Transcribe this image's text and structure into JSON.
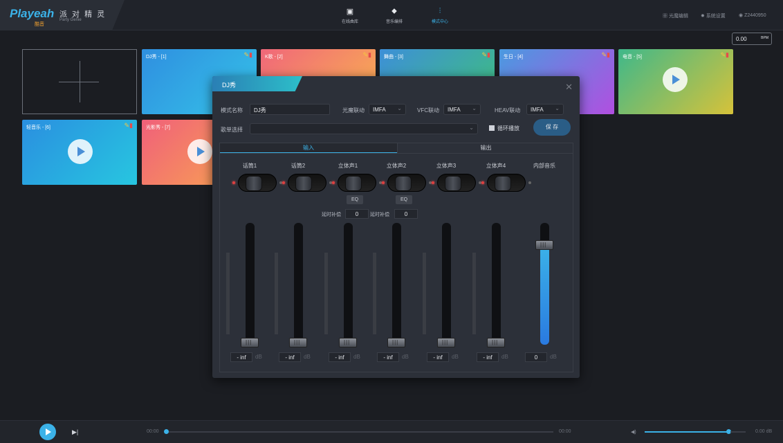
{
  "app": {
    "logo": "Playeah",
    "logo_sub": "酷音",
    "name_cn": "派 对 精 灵",
    "name_en": "Party Genie"
  },
  "nav": [
    {
      "label": "在线曲库",
      "icon": "music-box-icon"
    },
    {
      "label": "音乐编排",
      "icon": "arrange-icon"
    },
    {
      "label": "模式中心",
      "icon": "mixer-icon"
    }
  ],
  "topright": {
    "light_edit": "光魔编辑",
    "settings": "系统设置",
    "user": "Z2440950"
  },
  "bpm": {
    "value": "0.00",
    "unit": "BPM"
  },
  "cards": [
    {
      "title": "DJ秀 - [1]",
      "colors": [
        "#2f8fe0",
        "#35c3e8"
      ]
    },
    {
      "title": "K歌 - [2]",
      "colors": [
        "#f0677a",
        "#f9b34f"
      ]
    },
    {
      "title": "舞曲 - [3]",
      "colors": [
        "#3d8fd8",
        "#3fc17a"
      ]
    },
    {
      "title": "生日 - [4]",
      "colors": [
        "#4a9ae0",
        "#b14fe0"
      ]
    },
    {
      "title": "电音 - [5]",
      "colors": [
        "#3fb88a",
        "#d6c23a"
      ]
    },
    {
      "title": "轻音乐 - [6]",
      "colors": [
        "#2a8fe0",
        "#27c6e0"
      ]
    },
    {
      "title": "光影秀 - [7]",
      "colors": [
        "#f0607a",
        "#f9a84f"
      ]
    }
  ],
  "modal": {
    "title": "DJ秀",
    "mode_name_label": "模式名称",
    "mode_name_value": "DJ秀",
    "light_label": "光魔联动",
    "light_value": "IMFA",
    "vfc_label": "VFC联动",
    "vfc_value": "IMFA",
    "heav_label": "HEAV联动",
    "heav_value": "IMFA",
    "playlist_label": "歌单选择",
    "playlist_value": "",
    "loop_label": "循环播放",
    "save_label": "保 存",
    "tab_input": "输入",
    "tab_output": "输出",
    "eq_label": "EQ",
    "delay_label": "延时补偿",
    "delay_value": "0",
    "db_unit": "dB",
    "channels": [
      {
        "name": "话筒1",
        "db": "- inf",
        "level": 0
      },
      {
        "name": "话筒2",
        "db": "- inf",
        "level": 0
      },
      {
        "name": "立体声1",
        "db": "- inf",
        "level": 0
      },
      {
        "name": "立体声2",
        "db": "- inf",
        "level": 0
      },
      {
        "name": "立体声3",
        "db": "- inf",
        "level": 0
      },
      {
        "name": "立体声4",
        "db": "- inf",
        "level": 0
      },
      {
        "name": "内部音乐",
        "db": "0",
        "level": 0.82
      }
    ]
  },
  "player": {
    "time_start": "00:00",
    "time_end": "00:00",
    "volume_db": "0.00 dB",
    "volume_level": 0.85
  }
}
